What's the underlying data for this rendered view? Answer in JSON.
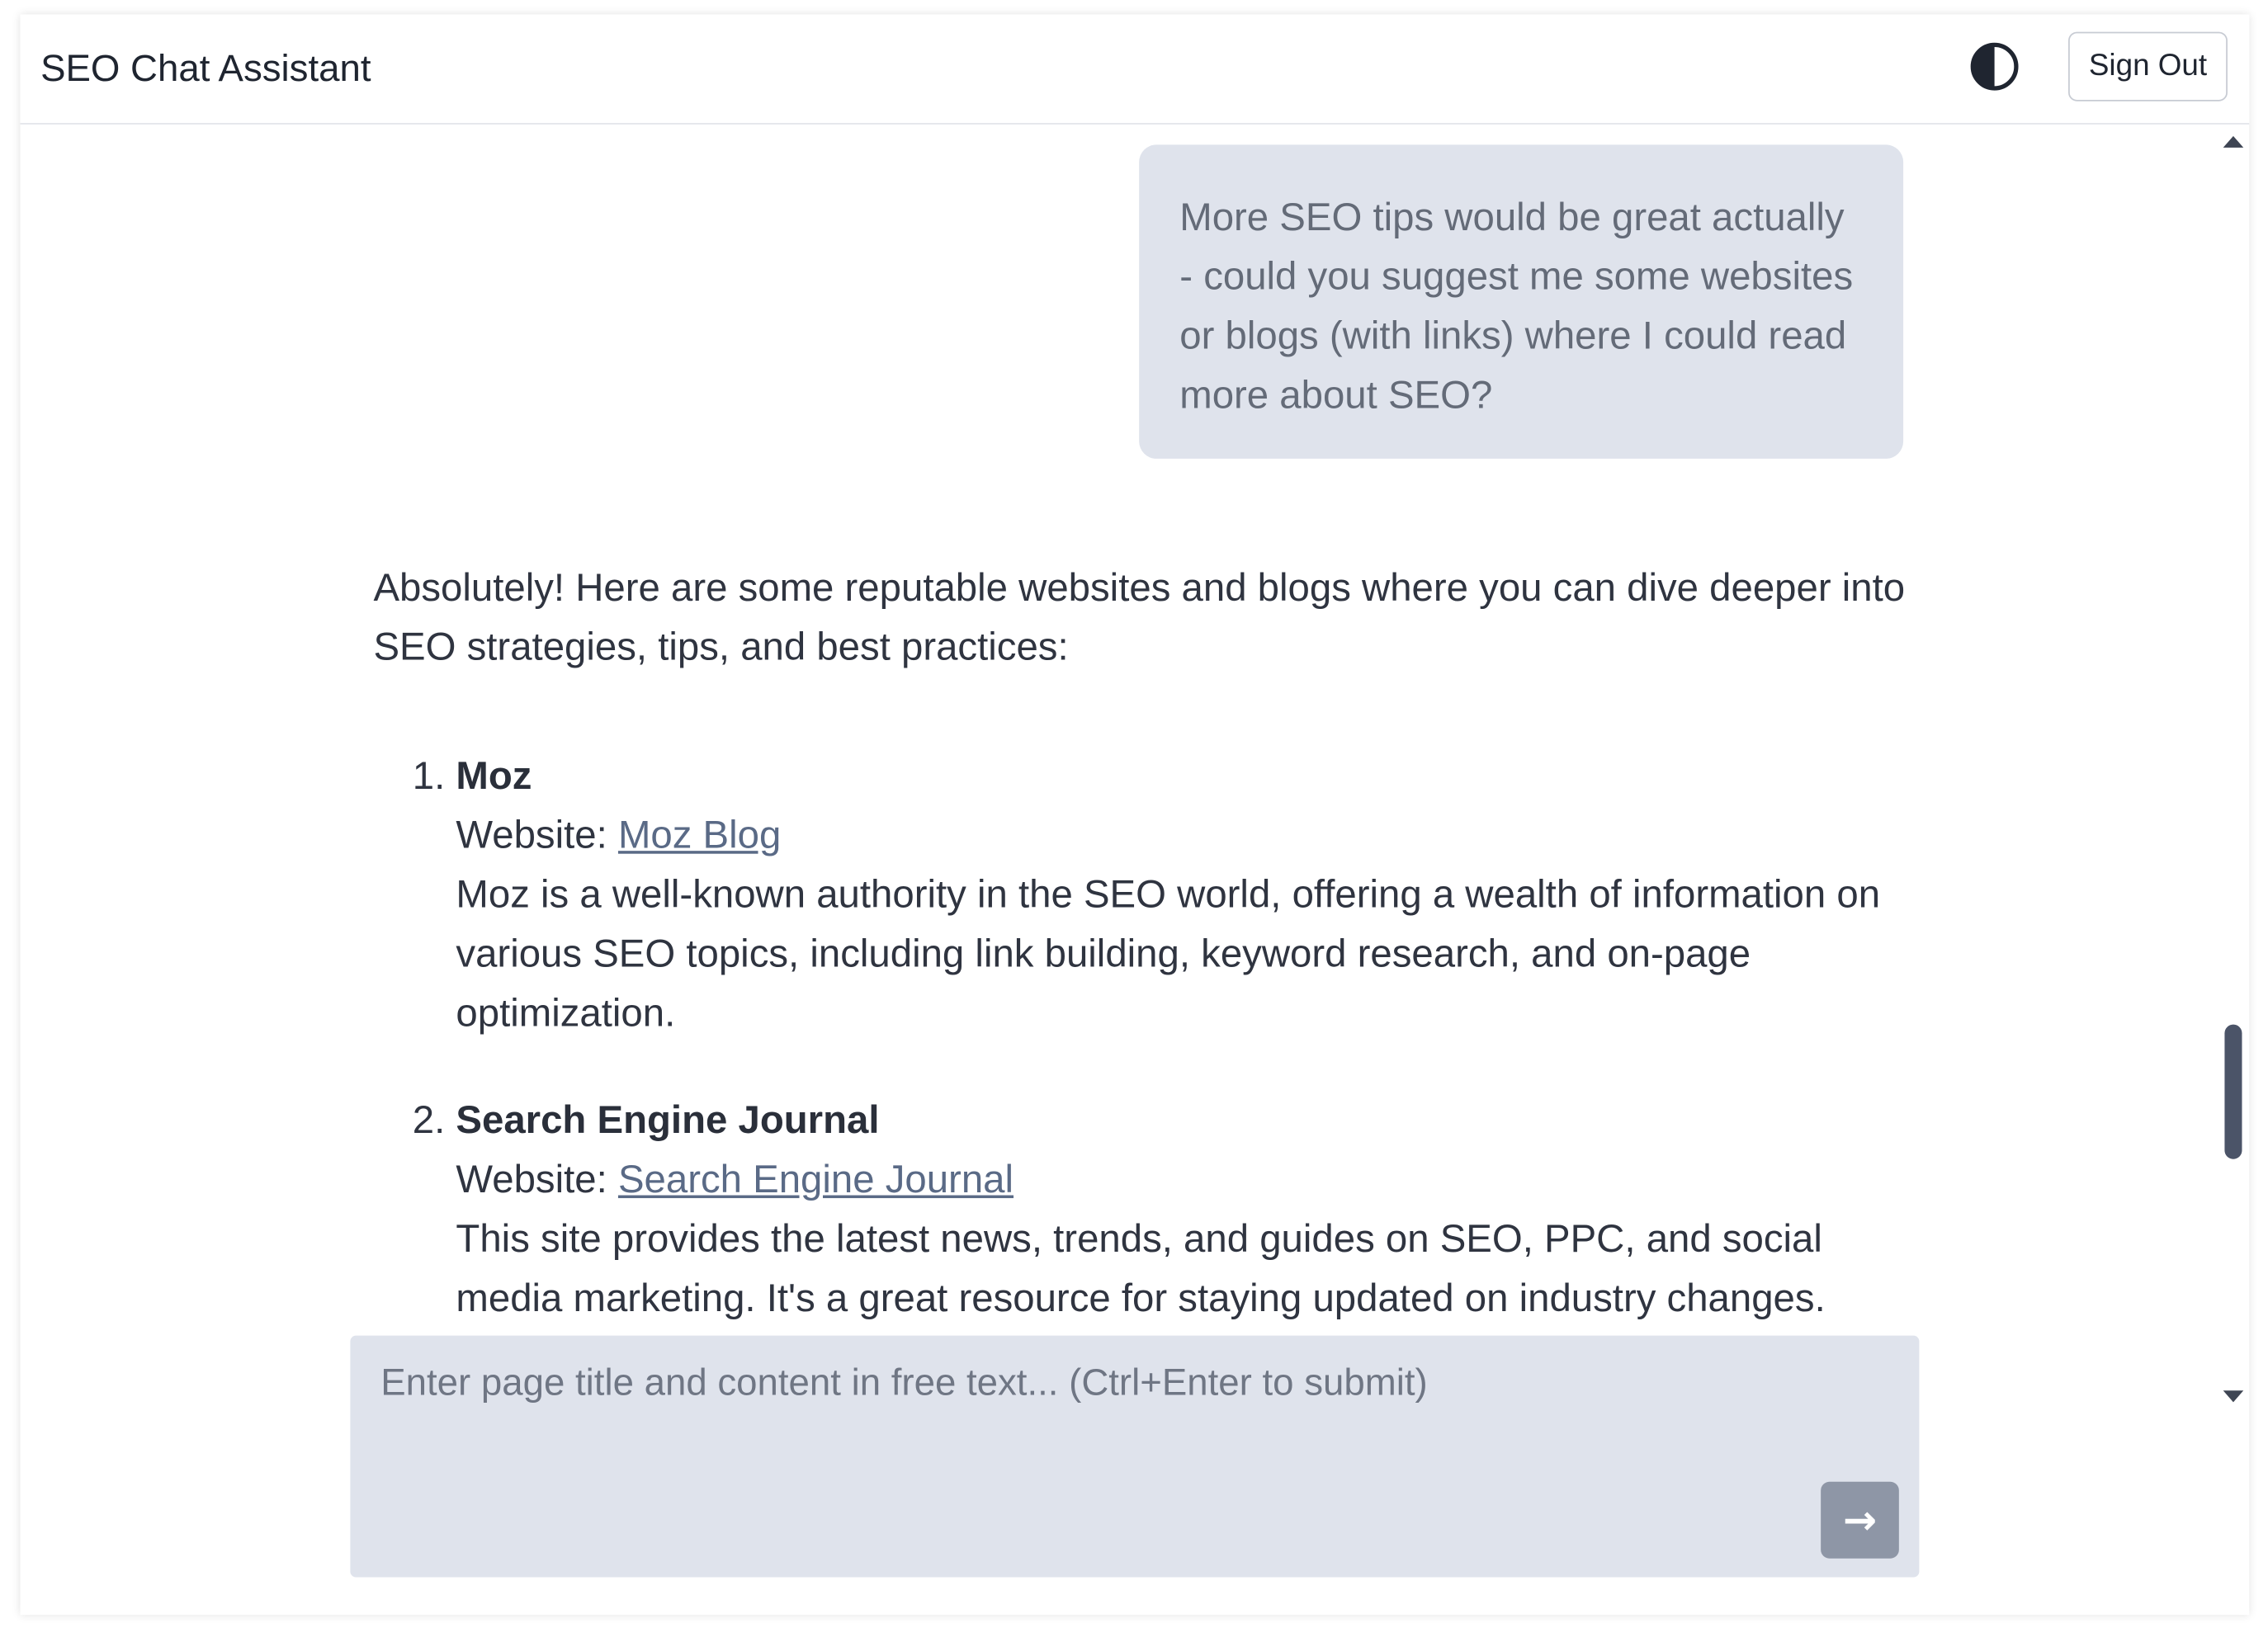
{
  "header": {
    "title": "SEO Chat Assistant",
    "theme_toggle_icon": "contrast-icon",
    "sign_out_label": "Sign Out"
  },
  "chat": {
    "user_message": "More SEO tips would be great actually - could you suggest me some websites or blogs (with links) where I could read more about SEO?",
    "assistant": {
      "intro": "Absolutely! Here are some reputable websites and blogs where you can dive deeper into SEO strategies, tips, and best practices:",
      "items": [
        {
          "name": "Moz",
          "website_label": "Website: ",
          "link_text": "Moz Blog",
          "description": "Moz is a well-known authority in the SEO world, offering a wealth of information on various SEO topics, including link building, keyword research, and on-page optimization."
        },
        {
          "name": "Search Engine Journal",
          "website_label": "Website: ",
          "link_text": "Search Engine Journal",
          "description": "This site provides the latest news, trends, and guides on SEO, PPC, and social media marketing. It's a great resource for staying updated on industry changes."
        }
      ]
    }
  },
  "composer": {
    "placeholder": "Enter page title and content in free text... (Ctrl+Enter to submit)",
    "value": "",
    "send_icon": "arrow-right-icon"
  },
  "colors": {
    "bubble_bg": "#dfe3ec",
    "link": "#5a6a86",
    "send_button": "#8e96a6",
    "scroll_thumb": "#4b5468"
  }
}
